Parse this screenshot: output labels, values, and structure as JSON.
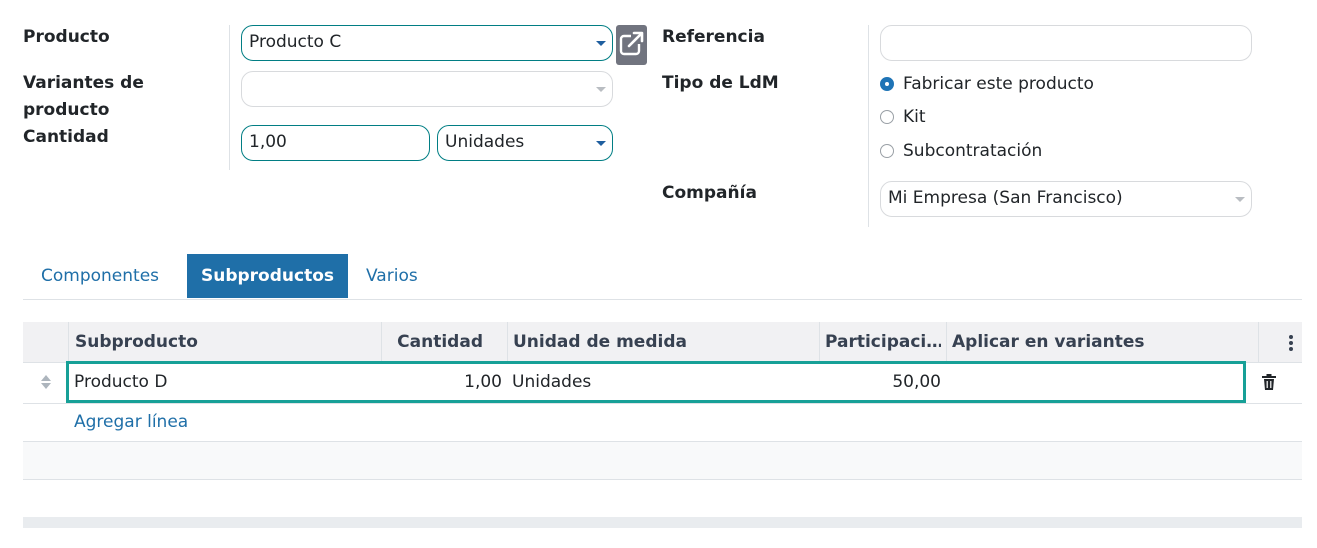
{
  "form": {
    "producto_label": "Producto",
    "producto_value": "Producto C",
    "variantes_label_1": "Variantes de",
    "variantes_label_2": "producto",
    "variantes_value": "",
    "cantidad_label": "Cantidad",
    "cantidad_value": "1,00",
    "unidad_value": "Unidades",
    "referencia_label": "Referencia",
    "referencia_value": "",
    "tipo_label": "Tipo de LdM",
    "tipo_options": [
      {
        "label": "Fabricar este producto",
        "selected": true
      },
      {
        "label": "Kit",
        "selected": false
      },
      {
        "label": "Subcontratación",
        "selected": false
      }
    ],
    "compania_label": "Compañía",
    "compania_value": "Mi Empresa (San Francisco)"
  },
  "tabs": [
    {
      "label": "Componentes",
      "active": false
    },
    {
      "label": "Subproductos",
      "active": true
    },
    {
      "label": "Varios",
      "active": false
    }
  ],
  "table": {
    "headers": [
      "Subproducto",
      "Cantidad",
      "Unidad de medida",
      "Participaci…",
      "Aplicar en variantes"
    ],
    "rows": [
      {
        "subproducto": "Producto D",
        "cantidad": "1,00",
        "unidad": "Unidades",
        "participacion": "50,00",
        "variantes": ""
      }
    ],
    "add_line": "Agregar línea"
  },
  "icons": {
    "external_link": "external-link-icon",
    "handle": "drag-handle-icon",
    "delete": "trash-icon",
    "options": "kebab-menu-icon"
  },
  "colors": {
    "accent": "#017e84",
    "tab_active": "#1f6fa8",
    "link": "#1f6fa8",
    "highlight": "#17a097",
    "radio": "#1f74b6"
  }
}
